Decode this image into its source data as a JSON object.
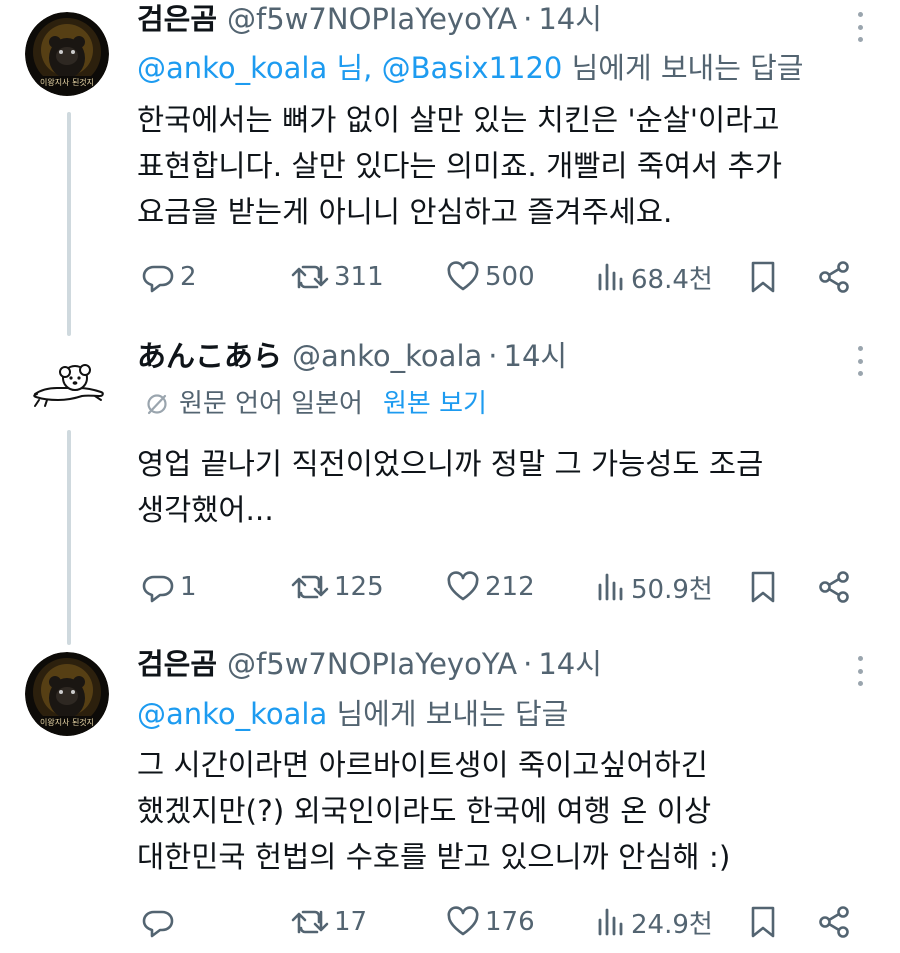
{
  "tweets": [
    {
      "name": "검은곰",
      "handle": "@f5w7NOPIaYeyoYA",
      "dot": "·",
      "time": "14시",
      "reply_mentions": "@anko_koala 님, @Basix1120",
      "reply_suffix": " 님에게 보내는 답글",
      "lines": [
        "한국에서는 뼈가 없이 살만 있는 치킨은 '순살'이라고",
        "표현합니다. 살만 있다는 의미죠. 개빨리 죽여서 추가",
        "요금을 받는게 아니니 안심하고 즐겨주세요."
      ],
      "replies": "2",
      "retweets": "311",
      "likes": "500",
      "views": "68.4천",
      "avatar_caption": "이왕지사 된것지"
    },
    {
      "name": "あんこあら",
      "handle": "@anko_koala",
      "dot": "·",
      "time": "14시",
      "translate_note": "원문 언어 일본어",
      "translate_link": "원본 보기",
      "lines": [
        "영업 끝나기 직전이었으니까 정말 그 가능성도 조금",
        "생각했어..."
      ],
      "replies": "1",
      "retweets": "125",
      "likes": "212",
      "views": "50.9천"
    },
    {
      "name": "검은곰",
      "handle": "@f5w7NOPIaYeyoYA",
      "dot": "·",
      "time": "14시",
      "reply_mentions": "@anko_koala",
      "reply_suffix": " 님에게 보내는 답글",
      "lines": [
        "그 시간이라면 아르바이트생이 죽이고싶어하긴",
        "했겠지만(?) 외국인이라도 한국에 여행 온 이상",
        "대한민국 헌법의 수호를 받고 있으니까 안심해 :)"
      ],
      "replies": "",
      "retweets": "17",
      "likes": "176",
      "views": "24.9천",
      "avatar_caption": "이왕지사 된것지"
    }
  ],
  "colors": {
    "text": "#0f1419",
    "secondary": "#536471",
    "link": "#1d9bf0",
    "thread_line": "#cfd9de"
  },
  "icons": [
    "reply-icon",
    "retweet-icon",
    "heart-icon",
    "views-icon",
    "bookmark-icon",
    "share-icon",
    "more-icon",
    "translate-icon"
  ]
}
